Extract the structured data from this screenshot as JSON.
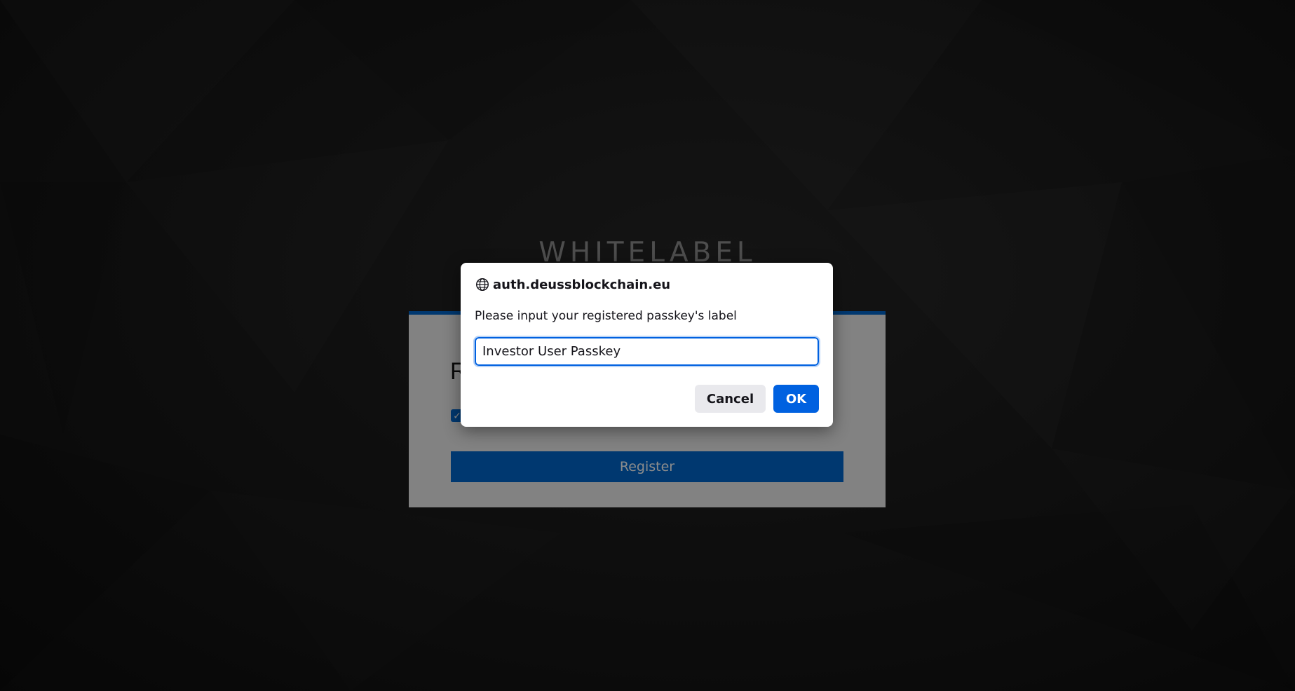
{
  "background": {
    "brand_title": "WHITELABEL"
  },
  "card": {
    "heading": "R",
    "register_label": "Register",
    "checkbox_checked": true,
    "accent_color": "#0066cc"
  },
  "dialog": {
    "origin": "auth.deussblockchain.eu",
    "origin_icon": "globe-icon",
    "message": "Please input your registered passkey's label",
    "input_value": "Investor User Passkey",
    "cancel_label": "Cancel",
    "ok_label": "OK",
    "accent_color": "#0061e0"
  }
}
